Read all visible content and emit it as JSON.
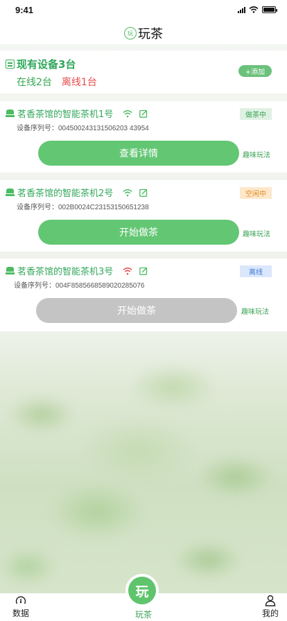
{
  "status_bar": {
    "time": "9:41"
  },
  "nav": {
    "logo_text": "玩",
    "title": "玩茶"
  },
  "summary": {
    "title": "现有设备3台",
    "online": "在线2台",
    "offline": "离线1台",
    "add_label": "+添加"
  },
  "devices": [
    {
      "name": "茗香茶馆的智能茶机1号",
      "serial": "设备序列号：004500243131506203 43954",
      "status": "做茶中",
      "button": "查看详情",
      "fun": "趣味玩法",
      "wifi_color": "#4cbb63"
    },
    {
      "name": "茗香茶馆的智能茶机2号",
      "serial": "设备序列号：002B0024C23153150651238",
      "status": "空闲中",
      "button": "开始做茶",
      "fun": "趣味玩法",
      "wifi_color": "#4cbb63"
    },
    {
      "name": "茗香茶馆的智能茶机3号",
      "serial": "设备序列号：004F8585668589020285076",
      "status": "离线",
      "button": "开始做茶",
      "fun": "趣味玩法",
      "wifi_color": "#e84a4a"
    }
  ],
  "tabbar": {
    "data_label": "数据",
    "center_label": "玩茶",
    "center_icon_text": "玩",
    "mine_label": "我的"
  },
  "colors": {
    "accent": "#63c673",
    "online": "#34a751",
    "offline": "#e84a4a"
  }
}
